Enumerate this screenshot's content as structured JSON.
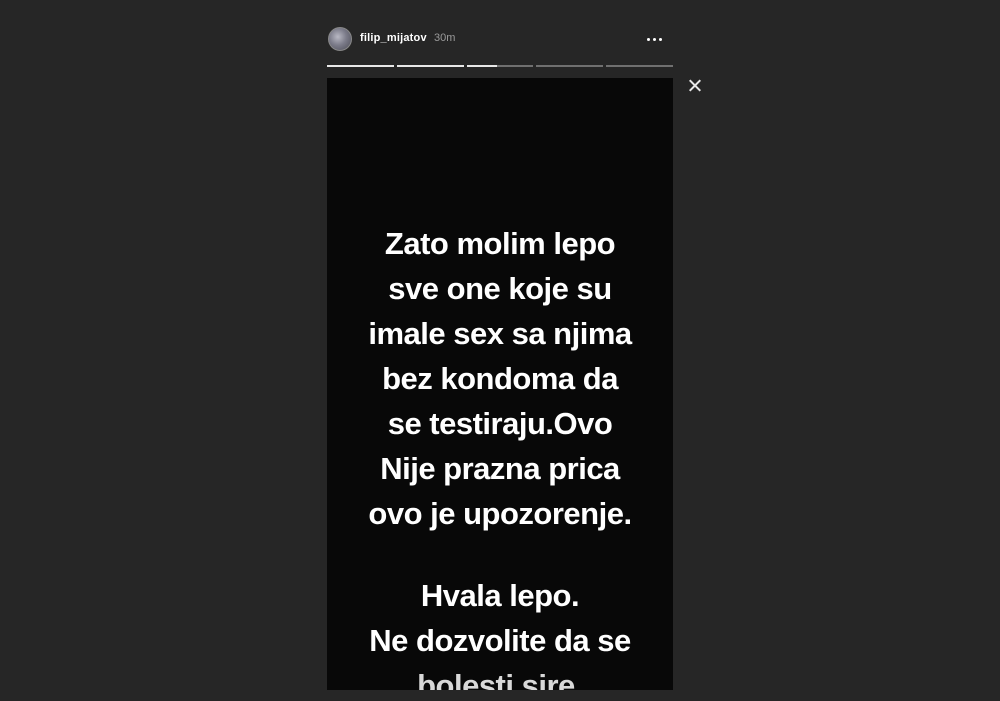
{
  "story": {
    "username": "filip_mijatov",
    "timestamp": "30m",
    "more_icon": "more-horizontal-icon",
    "close_icon": "close-icon",
    "progress": [
      1,
      1,
      0.45,
      0,
      0
    ],
    "lines": [
      "Zato molim lepo",
      "sve one koje su",
      "imale sex sa njima",
      "bez kondoma da",
      "se testiraju.Ovo",
      "Nije prazna prica",
      "ovo je upozorenje.",
      "Hvala lepo.",
      "Ne dozvolite da se",
      "bolesti sire."
    ]
  },
  "colors": {
    "page_background": "#262626",
    "story_background": "#080808",
    "text": "#ffffff",
    "progress_track": "#707070",
    "progress_fill": "#e8e8e8"
  }
}
